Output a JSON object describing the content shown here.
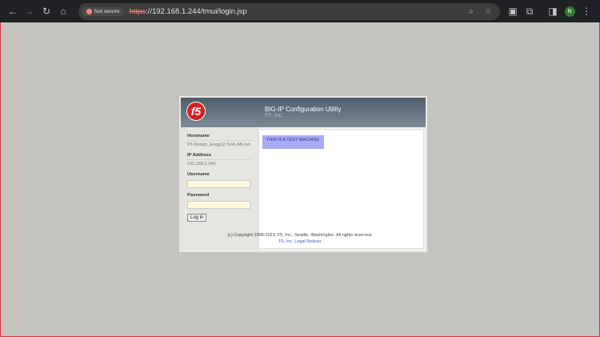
{
  "browser": {
    "security_label": "Not secure",
    "url_scheme": "https",
    "url_rest": "://192.168.1.244/tmui/login.jsp",
    "profile_initial": "N"
  },
  "header": {
    "title": "BIG-IP Configuration Utility",
    "company": "F5, Inc.",
    "logo_text": "f5"
  },
  "sidebar": {
    "hostname_label": "Hostname",
    "hostname": "F5-Design_Engg02.TestLAB.net",
    "ip_label": "IP Address",
    "ip": "192.168.1.244",
    "username_label": "Username",
    "username_value": "",
    "password_label": "Password",
    "password_value": "",
    "login_button": "Log in"
  },
  "main": {
    "banner": "THIS IS A TEST MACHINE"
  },
  "footer": {
    "copyright": "(c) Copyright 1996-2023, F5, Inc., Seattle, Washington. All rights reserved.",
    "legal_link": "F5, Inc. Legal Notices"
  }
}
